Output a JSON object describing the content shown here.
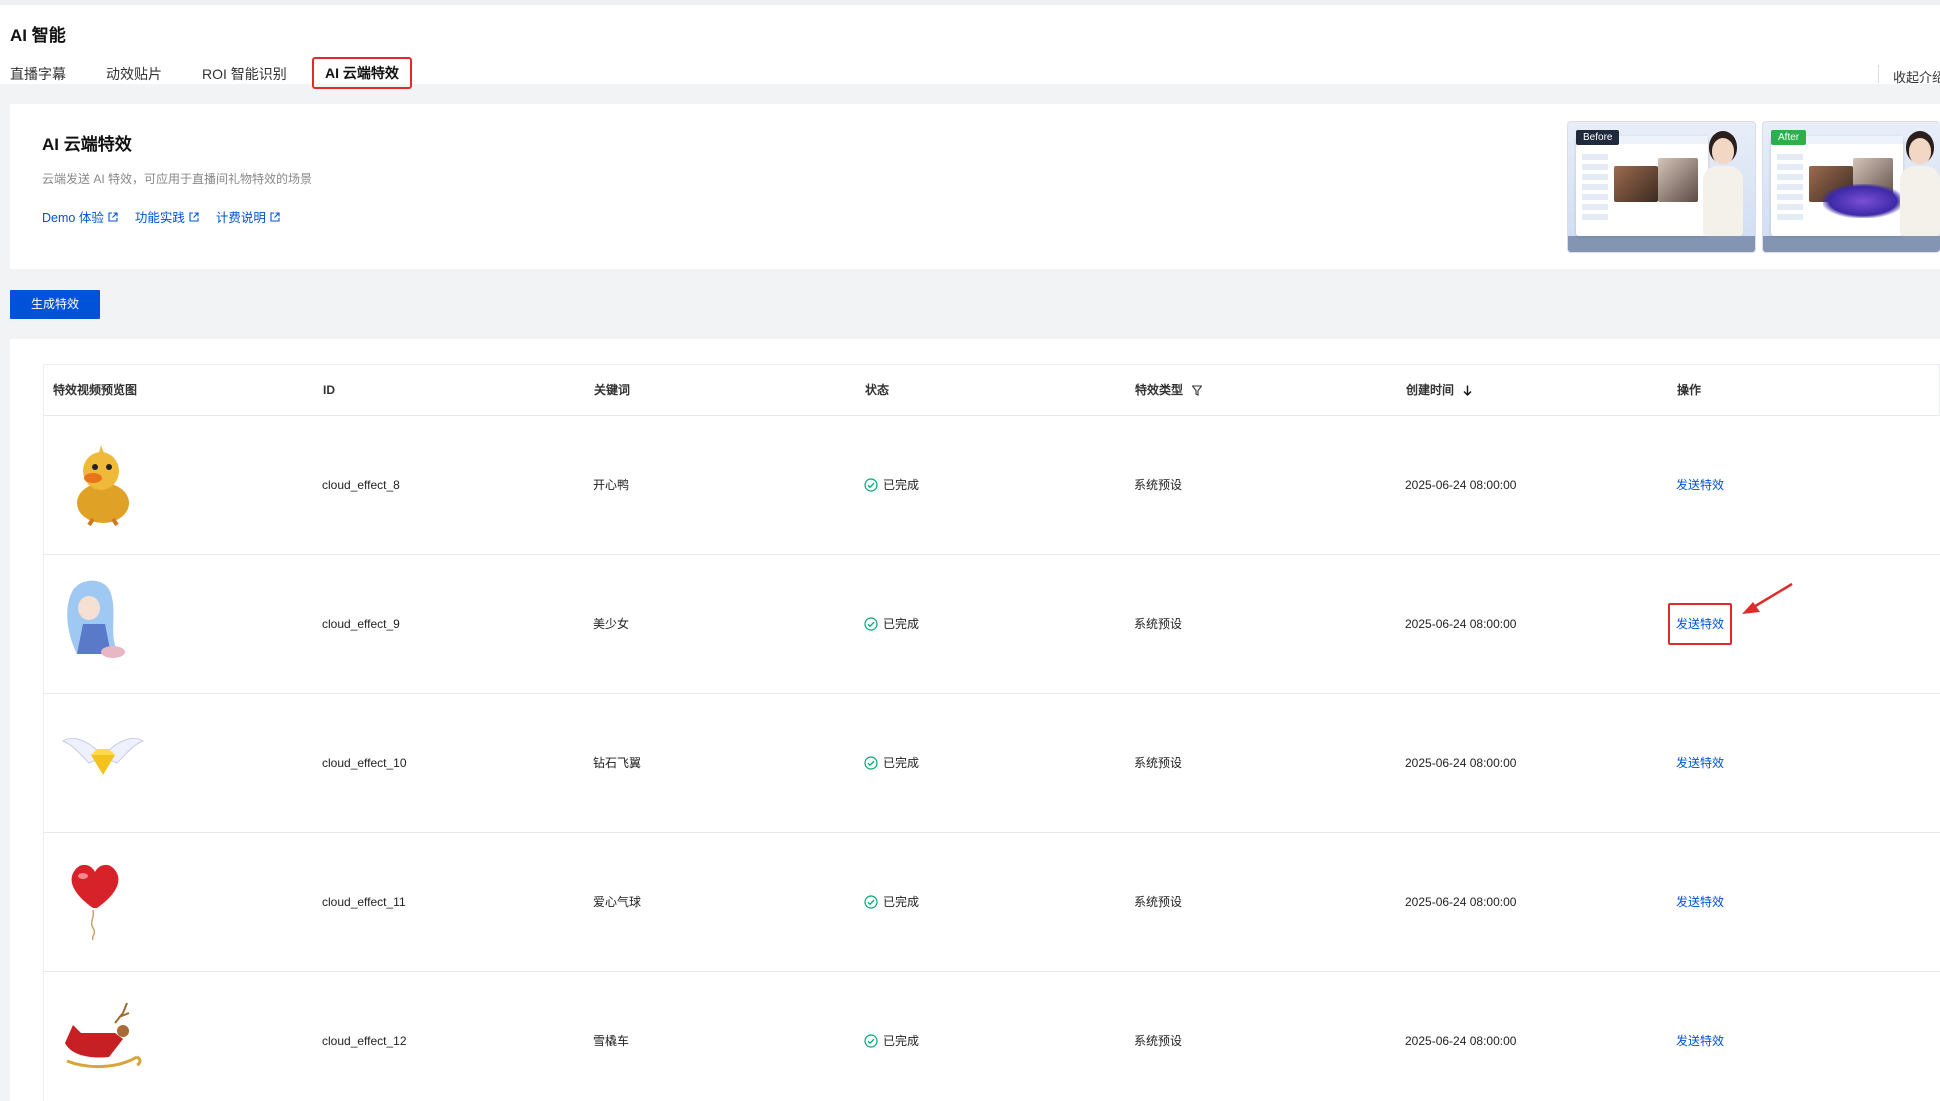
{
  "header": {
    "title": "AI 智能",
    "tabs": [
      {
        "label": "直播字幕",
        "active": false
      },
      {
        "label": "动效贴片",
        "active": false
      },
      {
        "label": "ROI 智能识别",
        "active": false
      },
      {
        "label": "AI 云端特效",
        "active": true
      }
    ],
    "collapse_label": "收起介绍"
  },
  "intro": {
    "title": "AI 云端特效",
    "description": "云端发送 AI 特效，可应用于直播间礼物特效的场景",
    "links": [
      "Demo 体验",
      "功能实践",
      "计费说明"
    ],
    "preview_before_tag": "Before",
    "preview_after_tag": "After"
  },
  "toolbar": {
    "create_label": "生成特效"
  },
  "table": {
    "columns": [
      "特效视频预览图",
      "ID",
      "关键词",
      "状态",
      "特效类型",
      "创建时间",
      "操作"
    ],
    "rows": [
      {
        "thumb_icon": "duck-icon",
        "id": "cloud_effect_8",
        "keyword": "开心鸭",
        "status": "已完成",
        "type": "系统预设",
        "created": "2025-06-24 08:00:00",
        "action": "发送特效"
      },
      {
        "thumb_icon": "anime-girl-icon",
        "id": "cloud_effect_9",
        "keyword": "美少女",
        "status": "已完成",
        "type": "系统预设",
        "created": "2025-06-24 08:00:00",
        "action": "发送特效"
      },
      {
        "thumb_icon": "diamond-wings-icon",
        "id": "cloud_effect_10",
        "keyword": "钻石飞翼",
        "status": "已完成",
        "type": "系统预设",
        "created": "2025-06-24 08:00:00",
        "action": "发送特效"
      },
      {
        "thumb_icon": "heart-balloon-icon",
        "id": "cloud_effect_11",
        "keyword": "爱心气球",
        "status": "已完成",
        "type": "系统预设",
        "created": "2025-06-24 08:00:00",
        "action": "发送特效"
      },
      {
        "thumb_icon": "sleigh-icon",
        "id": "cloud_effect_12",
        "keyword": "雪橇车",
        "status": "已完成",
        "type": "系统预设",
        "created": "2025-06-24 08:00:00",
        "action": "发送特效"
      }
    ]
  },
  "colors": {
    "primary": "#0052d9",
    "success": "#00a870",
    "highlight": "#e02b2b"
  }
}
